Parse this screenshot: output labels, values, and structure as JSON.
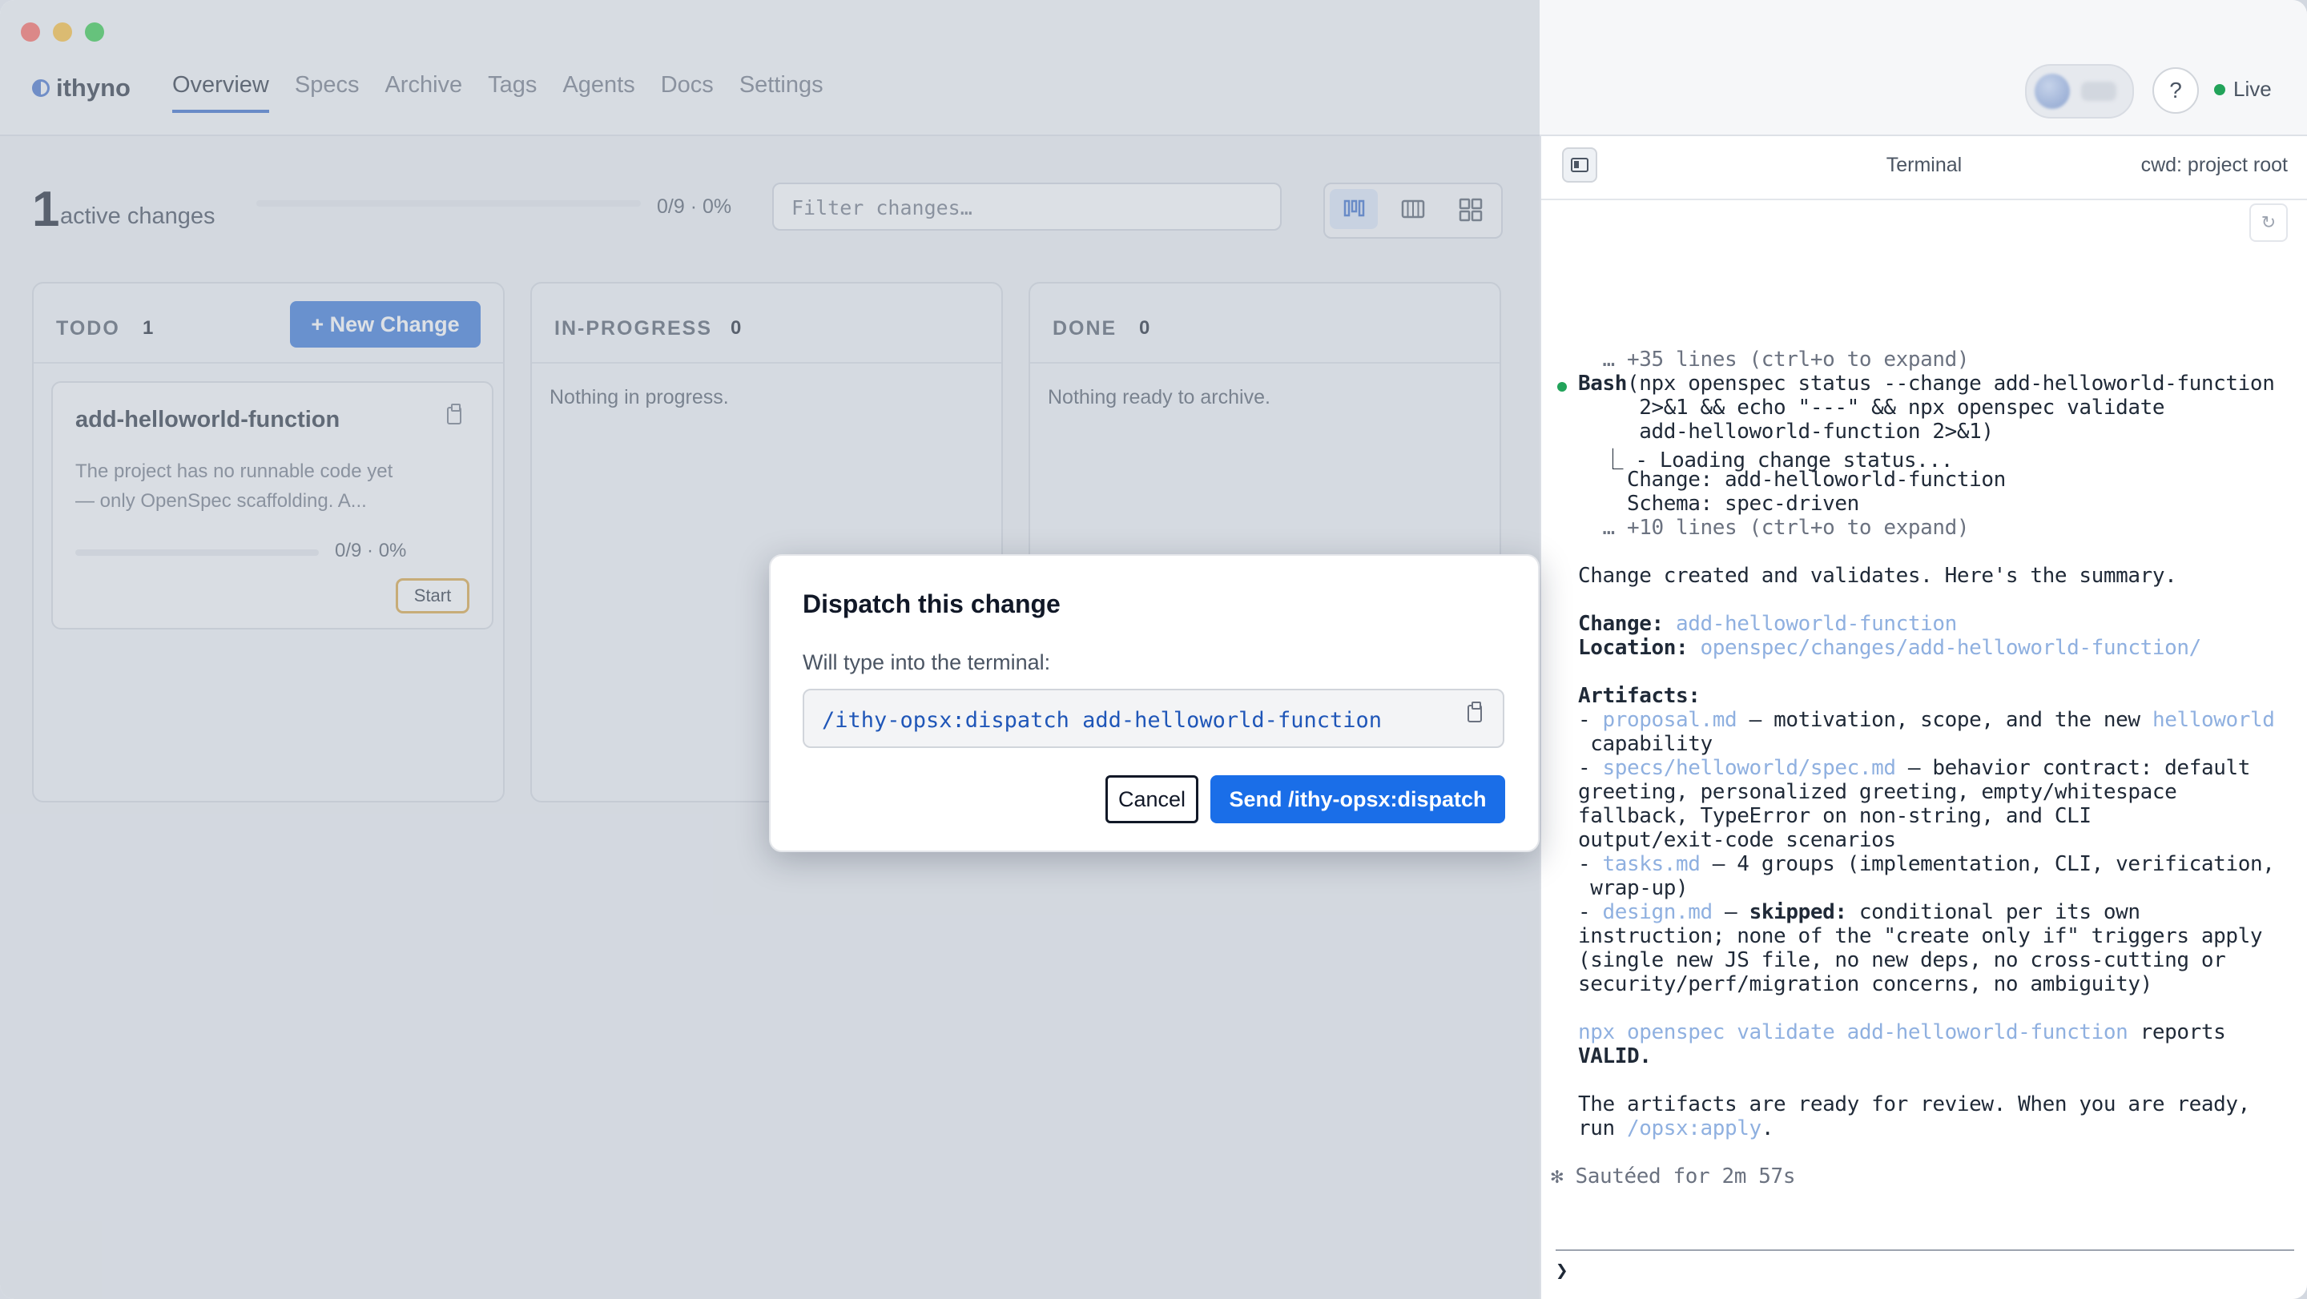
{
  "app": {
    "name": "ithyno"
  },
  "nav": {
    "items": [
      "Overview",
      "Specs",
      "Archive",
      "Tags",
      "Agents",
      "Docs",
      "Settings"
    ],
    "active": "Overview"
  },
  "header": {
    "help": "?",
    "live": "Live"
  },
  "summary": {
    "count": "1",
    "label": "active changes",
    "progress_text": "0/9 · 0%",
    "progress": 0
  },
  "filter": {
    "placeholder": "Filter changes…"
  },
  "columns": [
    {
      "title": "TODO",
      "count": "1",
      "new_button": "+ New Change"
    },
    {
      "title": "IN-PROGRESS",
      "count": "0",
      "empty": "Nothing in progress."
    },
    {
      "title": "DONE",
      "count": "0",
      "empty": "Nothing ready to archive."
    }
  ],
  "card": {
    "title": "add-helloworld-function",
    "desc1": "The project has no runnable code yet",
    "desc2": "— only OpenSpec scaffolding. A...",
    "progress_text": "0/9 · 0%",
    "progress": 0,
    "start": "Start"
  },
  "terminal": {
    "title": "Terminal",
    "cwd": "cwd: project root",
    "prompt": "❯",
    "lines": {
      "l01": "  … +35 lines (ctrl+o to expand)",
      "bash_label": "Bash",
      "l02": "(npx openspec status --change add-helloworld-function",
      "l03": "     2>&1 && echo \"---\" && npx openspec validate",
      "l04": "     add-helloworld-function 2>&1)",
      "l05": "  ⎿ - Loading change status...",
      "l06": "    Change: add-helloworld-function",
      "l07": "    Schema: spec-driven",
      "l08": "  … +10 lines (ctrl+o to expand)",
      "l09": "Change created and validates. Here's the summary.",
      "change_label": "Change:",
      "change_val": " add-helloworld-function",
      "location_label": "Location:",
      "location_val": " openspec/changes/add-helloworld-function/",
      "artifacts_label": "Artifacts:",
      "a1_dash": "- ",
      "a1_link": "proposal.md",
      "a1_rest": " — motivation, scope, and the new ",
      "a1_link2": "helloworld",
      "a1_cont": " capability",
      "a2_link": "specs/helloworld/spec.md",
      "a2_rest": " — behavior contract: default",
      "a2_c1": "greeting, personalized greeting, empty/whitespace",
      "a2_c2": "fallback, TypeError on non-string, and CLI",
      "a2_c3": "output/exit-code scenarios",
      "a3_link": "tasks.md",
      "a3_rest": " — 4 groups (implementation, CLI, verification,",
      "a3_cont": " wrap-up)",
      "a4_link": "design.md",
      "a4_mid": " — ",
      "a4_bold": "skipped:",
      "a4_rest": " conditional per its own",
      "a4_c1": "instruction; none of the \"create only if\" triggers apply",
      "a4_c2": "(single new JS file, no new deps, no cross-cutting or",
      "a4_c3": "security/perf/migration concerns, no ambiguity)",
      "v_link": "npx openspec validate add-helloworld-function",
      "v_rest": " reports",
      "v_valid": "VALID.",
      "r1": "The artifacts are ready for review. When you are ready,",
      "r2_pre": "run ",
      "r2_link": "/opsx:apply",
      "r2_post": ".",
      "sauteed": "✻ Sautéed for 2m 57s"
    }
  },
  "modal": {
    "title": "Dispatch this change",
    "subtitle": "Will type into the terminal:",
    "command": "/ithy-opsx:dispatch add-helloworld-function",
    "cancel": "Cancel",
    "send": "Send /ithy-opsx:dispatch"
  }
}
